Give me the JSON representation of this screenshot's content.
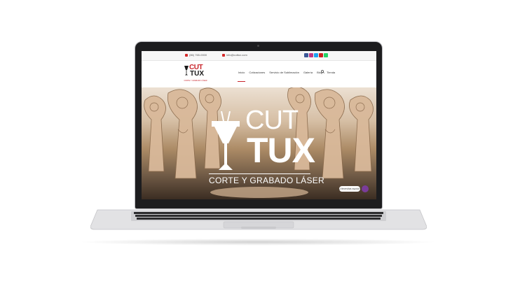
{
  "topbar": {
    "phone": "(86) 765-0000",
    "email": "info@cuttux.com",
    "social_icons": [
      "facebook-icon",
      "instagram-icon",
      "twitter-icon",
      "youtube-icon",
      "whatsapp-icon"
    ],
    "social_colors": [
      "#3b5998",
      "#c13584",
      "#1da1f2",
      "#cd201f",
      "#25d366"
    ]
  },
  "logo": {
    "top": "CUT",
    "bottom": "TUX",
    "tagline": "CORTE Y GRABADO LÁSER"
  },
  "nav": {
    "items": [
      "Inicio",
      "Cotizaciones",
      "Servicio de Sublimación",
      "Galería",
      "Blog",
      "Tienda"
    ],
    "search_icon": "search-icon"
  },
  "hero": {
    "top": "CUT",
    "bottom": "TUX",
    "tagline": "CORTE Y GRABADO LÁSER"
  },
  "chat": {
    "label": "¿Necesitas ayuda?",
    "icon": "chat-icon"
  },
  "colors": {
    "brand_red": "#c8242a",
    "laptop_body": "#1d1d1f",
    "chat_purple": "#7a3c9a"
  }
}
